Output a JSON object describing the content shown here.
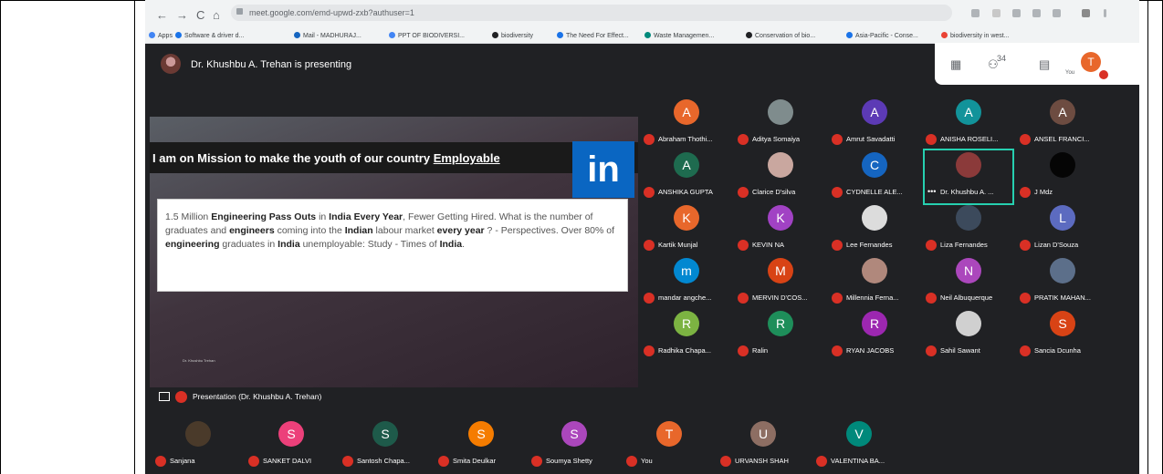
{
  "browser": {
    "nav_back": "←",
    "nav_forward": "→",
    "nav_reload": "C",
    "nav_home": "⌂",
    "url": "meet.google.com/emd-upwd-zxb?authuser=1",
    "bookmarks": [
      {
        "label": "Apps",
        "color": "#4285f4"
      },
      {
        "label": "Software & driver d...",
        "color": "#1a73e8"
      },
      {
        "label": "Mail - MADHURAJ...",
        "color": "#1565c0"
      },
      {
        "label": "PPT OF BIODIVERSI...",
        "color": "#4285f4"
      },
      {
        "label": "biodiversity",
        "color": "#202124"
      },
      {
        "label": "The Need For Effect...",
        "color": "#1a73e8"
      },
      {
        "label": "Waste Managemen...",
        "color": "#00897b"
      },
      {
        "label": "Conservation of bio...",
        "color": "#202124"
      },
      {
        "label": "Asia-Pacific - Conse...",
        "color": "#1a73e8"
      },
      {
        "label": "biodiversity in west...",
        "color": "#ea4335"
      }
    ]
  },
  "meet": {
    "presenter_text": "Dr. Khushbu A. Trehan is presenting",
    "participant_count": "34",
    "you_label": "You",
    "you_initial": "T",
    "presentation_label": "Presentation (Dr. Khushbu A. Trehan)"
  },
  "slide": {
    "title_prefix": "I am on  Mission to make the youth of our country ",
    "title_underlined": "Employable",
    "logo": "in",
    "body": [
      {
        "t": "1.5 Million ",
        "b": false
      },
      {
        "t": "Engineering Pass Outs",
        "b": true
      },
      {
        "t": " in ",
        "b": false
      },
      {
        "t": "India Every Year",
        "b": true
      },
      {
        "t": ", Fewer Getting Hired. What is the number of graduates and ",
        "b": false
      },
      {
        "t": "engineers",
        "b": true
      },
      {
        "t": " coming into the ",
        "b": false
      },
      {
        "t": "Indian",
        "b": true
      },
      {
        "t": " labour market ",
        "b": false
      },
      {
        "t": "every year",
        "b": true
      },
      {
        "t": " ? - Perspectives. Over 80% of ",
        "b": false
      },
      {
        "t": "engineering",
        "b": true
      },
      {
        "t": " graduates in ",
        "b": false
      },
      {
        "t": "India",
        "b": true
      },
      {
        "t": " unemployable: Study - Times of ",
        "b": false
      },
      {
        "t": "India",
        "b": true
      },
      {
        "t": ".",
        "b": false
      }
    ],
    "footer": "Dr. Khushbu Trehan"
  },
  "participants": [
    {
      "name": "Abraham Thothi...",
      "initial": "A",
      "color": "#e8672b"
    },
    {
      "name": "Aditya Somaiya",
      "initial": "",
      "color": "#7f8c8d"
    },
    {
      "name": "Amrut Savadatti",
      "initial": "A",
      "color": "#5c3ab5"
    },
    {
      "name": "ANISHA ROSELI...",
      "initial": "A",
      "color": "#12939a"
    },
    {
      "name": "ANSEL FRANCI...",
      "initial": "A",
      "color": "#6d4c41"
    },
    {
      "name": "ANSHIKA GUPTA",
      "initial": "A",
      "color": "#1e6b4f"
    },
    {
      "name": "Clarice D'silva",
      "initial": "",
      "color": "#c9a79f"
    },
    {
      "name": "CYDNELLE ALE...",
      "initial": "C",
      "color": "#1565c0"
    },
    {
      "name": "Dr. Khushbu A. ...",
      "initial": "",
      "color": "#8b3a3a",
      "active": true
    },
    {
      "name": "J Mdz",
      "initial": "",
      "color": "#050505"
    },
    {
      "name": "Kartik Munjal",
      "initial": "K",
      "color": "#e8672b"
    },
    {
      "name": "KEVIN NA",
      "initial": "K",
      "color": "#a142c4"
    },
    {
      "name": "Lee Fernandes",
      "initial": "",
      "color": "#dcdcdc"
    },
    {
      "name": "Liza Fernandes",
      "initial": "",
      "color": "#3c4a5c"
    },
    {
      "name": "Lizan D'Souza",
      "initial": "L",
      "color": "#5c6bc0"
    },
    {
      "name": "mandar angche...",
      "initial": "m",
      "color": "#0288d1"
    },
    {
      "name": "MERVIN D'COS...",
      "initial": "M",
      "color": "#d84315"
    },
    {
      "name": "Millennia Ferna...",
      "initial": "",
      "color": "#b0887c"
    },
    {
      "name": "Neil Albuquerque",
      "initial": "N",
      "color": "#ab47bc"
    },
    {
      "name": "PRATIK MAHAN...",
      "initial": "",
      "color": "#5c6f8a"
    },
    {
      "name": "Radhika Chapa...",
      "initial": "R",
      "color": "#7cb342"
    },
    {
      "name": "Ralin",
      "initial": "R",
      "color": "#1e8e5a"
    },
    {
      "name": "RYAN JACOBS",
      "initial": "R",
      "color": "#9c27b0"
    },
    {
      "name": "Sahil Sawant",
      "initial": "",
      "color": "#d0d0d0"
    },
    {
      "name": "Sancia Dcunha",
      "initial": "S",
      "color": "#d84315"
    }
  ],
  "bottom_row": [
    {
      "name": "Sanjana",
      "initial": "",
      "color": "#4a3a2a"
    },
    {
      "name": "SANKET DALVI",
      "initial": "S",
      "color": "#ec407a"
    },
    {
      "name": "Santosh Chapa...",
      "initial": "S",
      "color": "#1e5a4a"
    },
    {
      "name": "Smita Deulkar",
      "initial": "S",
      "color": "#f57c00"
    },
    {
      "name": "Soumya Shetty",
      "initial": "S",
      "color": "#ab47bc"
    },
    {
      "name": "You",
      "initial": "T",
      "color": "#e8672b"
    },
    {
      "name": "URVANSH SHAH",
      "initial": "U",
      "color": "#8d6e63"
    },
    {
      "name": "VALENTINA BA...",
      "initial": "V",
      "color": "#00897b"
    }
  ]
}
